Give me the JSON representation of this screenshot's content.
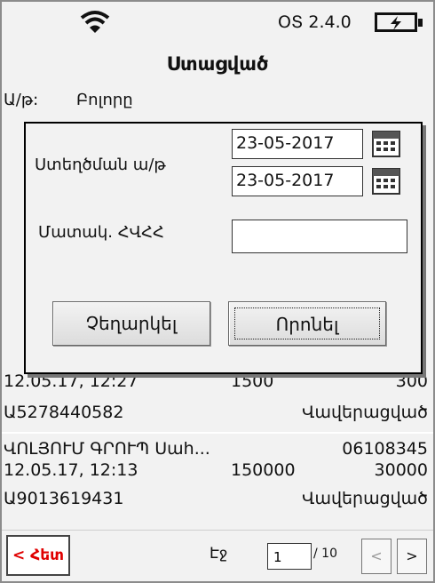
{
  "header": {
    "version": "ՕՏ 2.4.0",
    "title": "Ստացված"
  },
  "filter": {
    "label": "Ա/թ:",
    "value": "Բոլորը"
  },
  "list": {
    "items": [
      {
        "date": "12.05.17, 12:27",
        "amount": "1500",
        "vat": "300",
        "number": "Ա5278440582",
        "status": "Վավերացված"
      },
      {
        "name": "ՎՈԼՅՈՒՄ ԳՐՈՒՊ Սահ...",
        "tin": "06108345",
        "date": "12.05.17, 12:13",
        "amount": "150000",
        "vat": "30000",
        "number": "Ա9013619431",
        "status": "Վավերացված"
      }
    ]
  },
  "dialog": {
    "date_label": "Ստեղծման ա/թ",
    "date_from": "23-05-2017",
    "date_to": "23-05-2017",
    "tin_label": "Մատակ. ՀՎՀՀ",
    "tin_value": "",
    "cancel": "Չեղարկել",
    "search": "Որոնել"
  },
  "footer": {
    "back": "< Հետ",
    "page_label": "Էջ",
    "page": "1",
    "total": "/ 10",
    "prev": "<",
    "next": ">"
  },
  "colors": {
    "background": "#f2f2f2",
    "back_text": "#e00000",
    "border": "#000000"
  },
  "icons": [
    "wifi-icon",
    "battery-charging-icon",
    "calendar-icon"
  ]
}
